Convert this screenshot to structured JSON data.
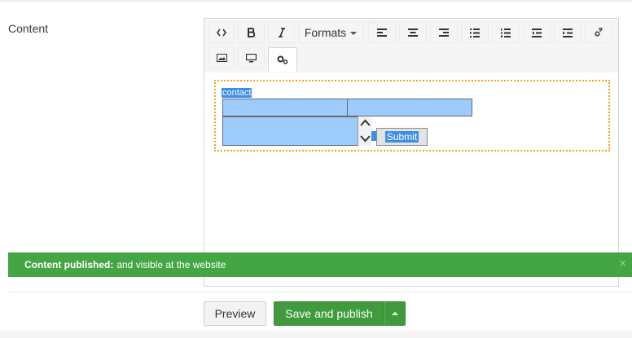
{
  "field": {
    "label": "Content"
  },
  "toolbar": {
    "formats_label": "Formats",
    "buttons": [
      {
        "icon": "source-code-icon"
      },
      {
        "icon": "bold-icon"
      },
      {
        "icon": "italic-icon"
      },
      {
        "icon": "formats-dropdown"
      },
      {
        "icon": "align-left-icon"
      },
      {
        "icon": "align-center-icon"
      },
      {
        "icon": "align-right-icon"
      },
      {
        "icon": "bullet-list-icon"
      },
      {
        "icon": "numbered-list-icon"
      },
      {
        "icon": "outdent-icon"
      },
      {
        "icon": "indent-icon"
      },
      {
        "icon": "link-icon"
      },
      {
        "icon": "image-icon"
      },
      {
        "icon": "embed-media-icon"
      },
      {
        "icon": "insert-macro-icon"
      }
    ]
  },
  "editor_content": {
    "form_label": "contact",
    "submit_label": "Submit"
  },
  "notification": {
    "title": "Content published:",
    "message": "and visible at the website",
    "close": "×"
  },
  "actions": {
    "preview_label": "Preview",
    "publish_label": "Save and publish"
  },
  "colors": {
    "success": "#43a543",
    "primary_button": "#3f9b3d",
    "macro_outline": "#f3a41b",
    "selection": "#3d8fe6",
    "input_highlight": "#9dcbfb"
  }
}
